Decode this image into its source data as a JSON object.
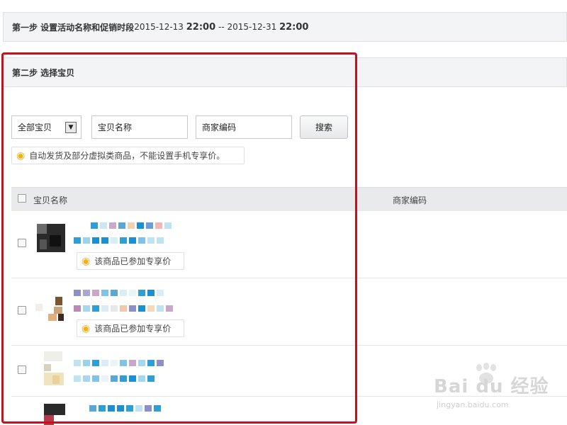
{
  "step1": {
    "label": "第一步 设置活动名称和促销时段",
    "start_date": "2015-12-13",
    "start_time": "22:00",
    "separator": "--",
    "end_date": "2015-12-31",
    "end_time": "22:00"
  },
  "step2": {
    "label": "第二步 选择宝贝"
  },
  "filter": {
    "selected": "全部宝贝"
  },
  "search": {
    "name_placeholder": "宝贝名称",
    "code_placeholder": "商家编码",
    "button_label": "搜索"
  },
  "notice": "自动发货及部分虚拟类商品，不能设置手机专享价。",
  "table": {
    "col_name": "宝贝名称",
    "col_code": "商家编码"
  },
  "rows": [
    {
      "badge": "该商品已参加专享价"
    },
    {
      "badge": "该商品已参加专享价"
    },
    {
      "badge": ""
    },
    {
      "badge": ""
    }
  ],
  "watermark": {
    "logo": "Bai du 经验",
    "url": "jingyan.baidu.com"
  },
  "colors": {
    "highlight": "#c0121f",
    "bulb": "#f4b019",
    "header_bg": "#f3f4f6"
  }
}
